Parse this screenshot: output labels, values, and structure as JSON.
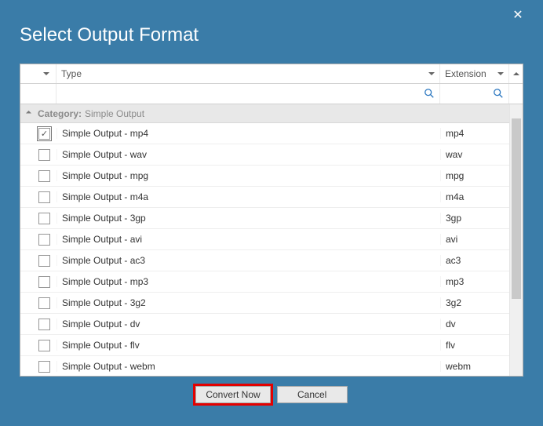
{
  "window": {
    "title": "Select Output Format"
  },
  "headers": {
    "type": "Type",
    "extension": "Extension"
  },
  "category": {
    "label": "Category:",
    "value": "Simple Output"
  },
  "rows": [
    {
      "type": "Simple Output - mp4",
      "ext": "mp4",
      "checked": true
    },
    {
      "type": "Simple Output - wav",
      "ext": "wav",
      "checked": false
    },
    {
      "type": "Simple Output - mpg",
      "ext": "mpg",
      "checked": false
    },
    {
      "type": "Simple Output - m4a",
      "ext": "m4a",
      "checked": false
    },
    {
      "type": "Simple Output - 3gp",
      "ext": "3gp",
      "checked": false
    },
    {
      "type": "Simple Output - avi",
      "ext": "avi",
      "checked": false
    },
    {
      "type": "Simple Output - ac3",
      "ext": "ac3",
      "checked": false
    },
    {
      "type": "Simple Output - mp3",
      "ext": "mp3",
      "checked": false
    },
    {
      "type": "Simple Output - 3g2",
      "ext": "3g2",
      "checked": false
    },
    {
      "type": "Simple Output - dv",
      "ext": "dv",
      "checked": false
    },
    {
      "type": "Simple Output - flv",
      "ext": "flv",
      "checked": false
    },
    {
      "type": "Simple Output - webm",
      "ext": "webm",
      "checked": false
    }
  ],
  "buttons": {
    "convert": "Convert Now",
    "cancel": "Cancel"
  }
}
